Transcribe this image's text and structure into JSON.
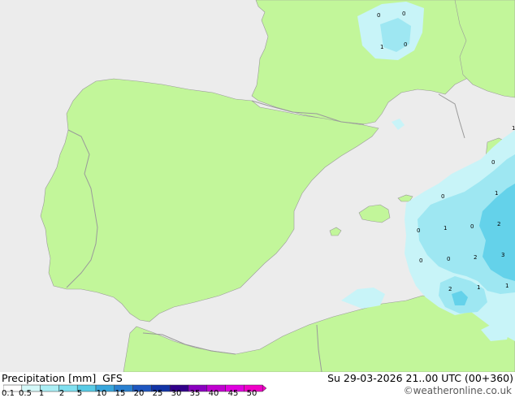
{
  "footer": {
    "title": "Precipitation [mm]",
    "model": "GFS",
    "datetime": "Su 29-03-2026 21..00 UTC (00+360)",
    "credit": "©weatheronline.co.uk"
  },
  "colors": {
    "sea": "#ececec",
    "land": "#c2f69a",
    "border": "#9a9a9a",
    "precip_light": "#c8f4f8",
    "precip_mid": "#9ee7f2",
    "precip_heavy": "#64d2ea"
  },
  "scale": {
    "labels": [
      "0.1",
      "0.5",
      "1",
      "2",
      "5",
      "10",
      "15",
      "20",
      "25",
      "30",
      "35",
      "40",
      "45",
      "50"
    ],
    "colors": [
      "#ffffff",
      "#d4f8f8",
      "#aaeef4",
      "#80e0f0",
      "#58cbe6",
      "#38a6dc",
      "#2a80d0",
      "#1e56c0",
      "#1234a6",
      "#32008a",
      "#8a00c0",
      "#c000d0",
      "#e000e0",
      "#f000c8"
    ]
  },
  "precip_labels": [
    {
      "v": "0"
    },
    {
      "v": "0"
    },
    {
      "v": "1"
    },
    {
      "v": "0"
    },
    {
      "v": "0"
    },
    {
      "v": "1"
    },
    {
      "v": "0"
    },
    {
      "v": "1"
    },
    {
      "v": "0"
    },
    {
      "v": "2"
    },
    {
      "v": "0"
    },
    {
      "v": "0"
    },
    {
      "v": "2"
    },
    {
      "v": "3"
    },
    {
      "v": "2"
    },
    {
      "v": "1"
    },
    {
      "v": "1"
    },
    {
      "v": "0"
    },
    {
      "v": "1"
    }
  ]
}
